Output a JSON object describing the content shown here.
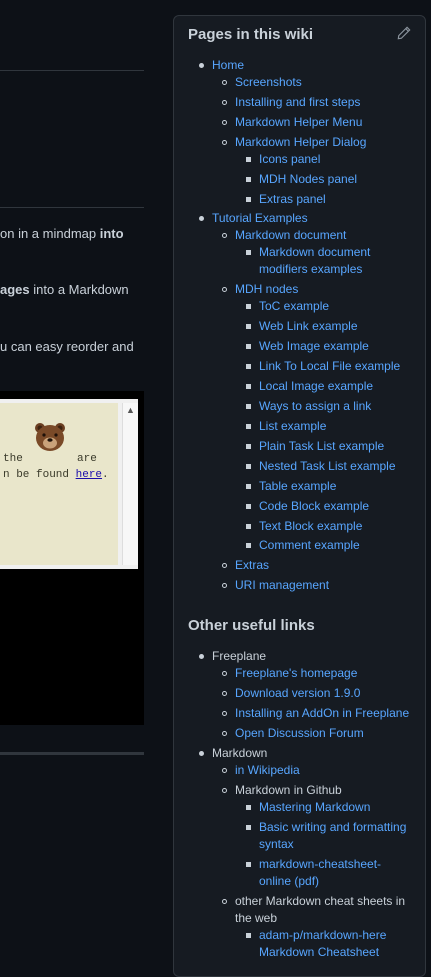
{
  "main": {
    "para1_before": "on in a mindmap",
    "para1_bold": "into",
    "para2_bold": "ages",
    "para2_after": "into a Markdown",
    "para3": "u can easy reorder and",
    "embed": {
      "line1_a": "the",
      "line1_b": "are",
      "line2_a": "n be found",
      "line2_link": "here",
      "line2_end": "."
    }
  },
  "sidebar": {
    "title": "Pages in this wiki",
    "pages": [
      {
        "label": "Home"
      },
      {
        "label": "Screenshots"
      },
      {
        "label": "Installing and first steps"
      },
      {
        "label": "Markdown Helper Menu"
      },
      {
        "label": "Markdown Helper Dialog"
      },
      {
        "label": "Icons panel"
      },
      {
        "label": "MDH Nodes panel"
      },
      {
        "label": "Extras panel"
      },
      {
        "label": "Tutorial Examples"
      },
      {
        "label": "Markdown document"
      },
      {
        "label": "Markdown document modifiers examples"
      },
      {
        "label": "MDH nodes"
      },
      {
        "label": "ToC example"
      },
      {
        "label": "Web Link example"
      },
      {
        "label": "Web Image example"
      },
      {
        "label": "Link To Local File example"
      },
      {
        "label": "Local Image example"
      },
      {
        "label": "Ways to assign a link"
      },
      {
        "label": "List example"
      },
      {
        "label": "Plain Task List example"
      },
      {
        "label": "Nested Task List example"
      },
      {
        "label": "Table example"
      },
      {
        "label": "Code Block example"
      },
      {
        "label": "Text Block example"
      },
      {
        "label": "Comment example"
      },
      {
        "label": "Extras"
      },
      {
        "label": "URI management"
      }
    ],
    "other_title": "Other useful links",
    "links": [
      {
        "label": "Freeplane"
      },
      {
        "label": "Freeplane's homepage"
      },
      {
        "label": "Download version 1.9.0"
      },
      {
        "label": "Installing an AddOn in Freeplane"
      },
      {
        "label": "Open Discussion Forum"
      },
      {
        "label": "Markdown"
      },
      {
        "label": "in Wikipedia"
      },
      {
        "label": "Markdown in Github"
      },
      {
        "label": "Mastering Markdown"
      },
      {
        "label": "Basic writing and formatting syntax"
      },
      {
        "label": "markdown-cheatsheet-online (pdf)"
      },
      {
        "label": "other Markdown cheat sheets in the web"
      },
      {
        "label": "adam-p/markdown-here Markdown Cheatsheet"
      }
    ]
  },
  "colors": {
    "link": "#58a6ff",
    "text": "#c9d1d9",
    "panel_bg": "#161b22",
    "page_bg": "#0d1117"
  }
}
